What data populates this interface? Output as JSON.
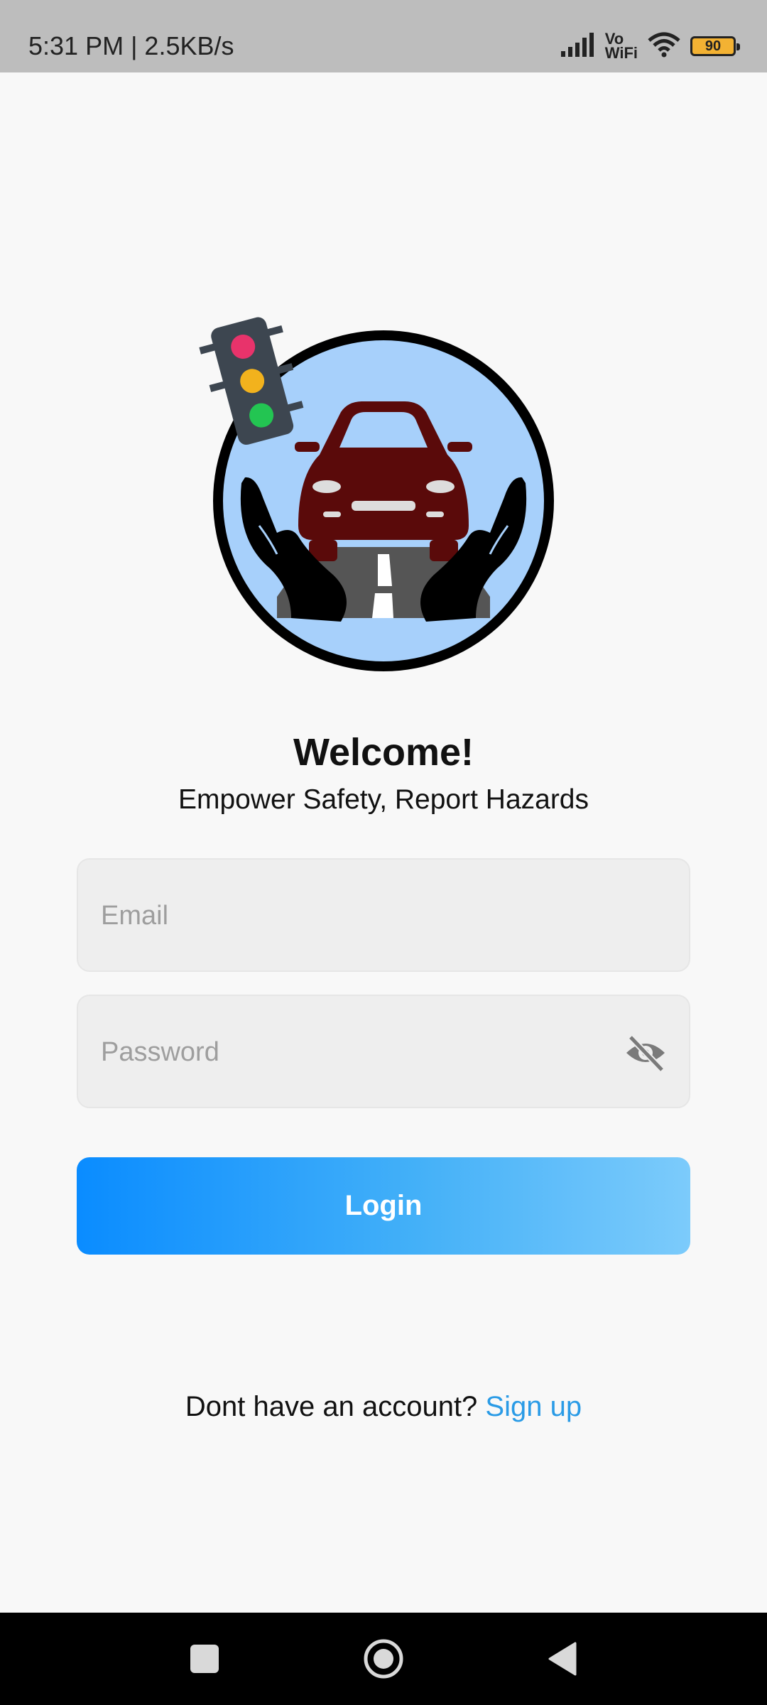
{
  "status_bar": {
    "time_speed": "5:31 PM | 2.5KB/s",
    "vowifi_line1": "Vo",
    "vowifi_line2": "WiFi",
    "battery_level": "90",
    "battery_color": "#f3b233"
  },
  "icons": {
    "signal": "signal-icon",
    "wifi": "wifi-icon",
    "battery": "battery-icon",
    "logo": "road-safety-logo",
    "eye": "eye-slash-icon",
    "nav_recent": "square-icon",
    "nav_home": "circle-icon",
    "nav_back": "triangle-back-icon"
  },
  "header": {
    "title": "Welcome!",
    "subtitle": "Empower Safety, Report Hazards"
  },
  "form": {
    "email_placeholder": "Email",
    "email_value": "",
    "password_placeholder": "Password",
    "password_value": "",
    "login_label": "Login"
  },
  "signup": {
    "prompt": "Dont have an account?",
    "link": "Sign up"
  },
  "colors": {
    "accent": "#0a8cff",
    "link": "#2a9be6",
    "background": "#f8f8f8",
    "logo_circle": "#a7d0fb",
    "car": "#5a0a0a"
  }
}
